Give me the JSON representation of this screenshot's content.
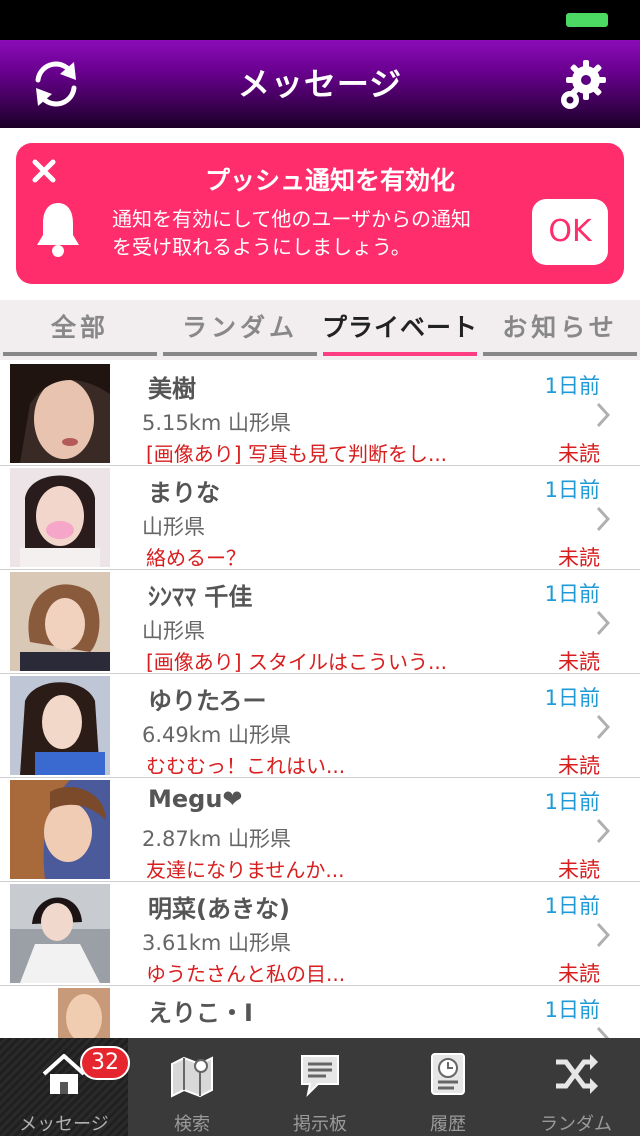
{
  "header": {
    "title": "メッセージ"
  },
  "banner": {
    "title": "プッシュ通知を有効化",
    "line1": "通知を有効にして他のユーザからの通知",
    "line2": "を受け取れるようにしましょう。",
    "ok_label": "OK"
  },
  "tabs": [
    {
      "label": "全部",
      "active": false
    },
    {
      "label": "ランダム",
      "active": false
    },
    {
      "label": "プライベート",
      "active": true
    },
    {
      "label": "お知らせ",
      "active": false
    }
  ],
  "messages": [
    {
      "name": "美樹",
      "time": "1日前",
      "location": "5.15km  山形県",
      "preview": "[画像あり] 写真も見て判断をし...",
      "status": "未読"
    },
    {
      "name": "まりな",
      "time": "1日前",
      "location": " 山形県",
      "preview": "絡めるー？",
      "status": "未読"
    },
    {
      "name": "ｼﾝﾏﾏ 千佳",
      "time": "1日前",
      "location": " 山形県",
      "preview": "[画像あり] スタイルはこういう...",
      "status": "未読"
    },
    {
      "name": "ゆりたろー",
      "time": "1日前",
      "location": "6.49km  山形県",
      "preview": "むむむっ！これはい...",
      "status": "未読"
    },
    {
      "name": "Megu❤",
      "time": "1日前",
      "location": "2.87km  山形県",
      "preview": "友達になりませんか...",
      "status": "未読"
    },
    {
      "name": "明菜(あきな)",
      "time": "1日前",
      "location": "3.61km  山形県",
      "preview": "ゆうたさんと私の目...",
      "status": "未読"
    },
    {
      "name": "えりこ・I",
      "time": "1日前",
      "location": "",
      "preview": "",
      "status": ""
    }
  ],
  "tabbar": {
    "items": [
      {
        "label": "メッセージ",
        "icon": "house-icon",
        "active": true
      },
      {
        "label": "検索",
        "icon": "map-icon",
        "active": false
      },
      {
        "label": "掲示板",
        "icon": "board-icon",
        "active": false
      },
      {
        "label": "履歴",
        "icon": "history-icon",
        "active": false
      },
      {
        "label": "ランダム",
        "icon": "shuffle-icon",
        "active": false
      }
    ],
    "badge": "32"
  },
  "colors": {
    "accent": "#ff2d6b",
    "nav": "#6a0090",
    "time": "#1e9ad6",
    "unread": "#d81e1e"
  }
}
